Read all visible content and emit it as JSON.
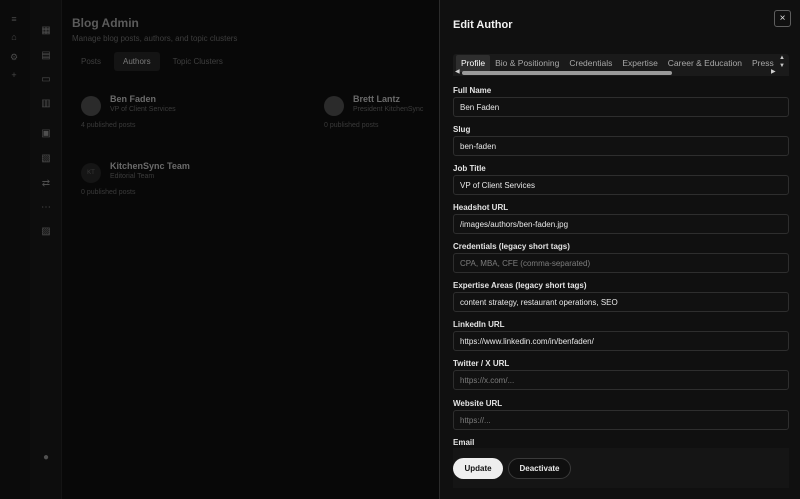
{
  "app": {
    "title": "Blog Admin",
    "subtitle": "Manage blog posts, authors, and topic clusters",
    "tabs": [
      {
        "label": "Posts"
      },
      {
        "label": "Authors"
      },
      {
        "label": "Topic Clusters"
      }
    ],
    "authors": [
      {
        "name": "Ben Faden",
        "role": "VP of Client Services",
        "count": "4 published posts"
      },
      {
        "name": "Brett Lantz",
        "role": "President KitchenSync",
        "count": "0 published posts"
      },
      {
        "name": "KitchenSync Team",
        "role": "Editorial Team",
        "count": "0 published posts",
        "initials": "KT"
      }
    ]
  },
  "drawer": {
    "title": "Edit Author",
    "close_icon": "×",
    "tabs": [
      {
        "label": "Profile"
      },
      {
        "label": "Bio & Positioning"
      },
      {
        "label": "Credentials"
      },
      {
        "label": "Expertise"
      },
      {
        "label": "Career & Education"
      },
      {
        "label": "Press"
      }
    ],
    "scroll": {
      "up": "▲",
      "down": "▼",
      "left": "◀",
      "right": "▶"
    },
    "fields": {
      "full_name": {
        "label": "Full Name",
        "value": "Ben Faden",
        "placeholder": ""
      },
      "slug": {
        "label": "Slug",
        "value": "ben-faden",
        "placeholder": ""
      },
      "job_title": {
        "label": "Job Title",
        "value": "VP of Client Services",
        "placeholder": ""
      },
      "headshot_url": {
        "label": "Headshot URL",
        "value": "/images/authors/ben-faden.jpg",
        "placeholder": ""
      },
      "credentials": {
        "label": "Credentials (legacy short tags)",
        "value": "",
        "placeholder": "CPA, MBA, CFE (comma-separated)"
      },
      "expertise_areas": {
        "label": "Expertise Areas (legacy short tags)",
        "value": "content strategy, restaurant operations, SEO",
        "placeholder": ""
      },
      "linkedin_url": {
        "label": "LinkedIn URL",
        "value": "https://www.linkedin.com/in/benfaden/",
        "placeholder": ""
      },
      "twitter_url": {
        "label": "Twitter / X URL",
        "value": "",
        "placeholder": "https://x.com/..."
      },
      "website_url": {
        "label": "Website URL",
        "value": "",
        "placeholder": "https://..."
      },
      "email": {
        "label": "Email"
      }
    },
    "buttons": {
      "update": "Update",
      "deactivate": "Deactivate"
    }
  }
}
